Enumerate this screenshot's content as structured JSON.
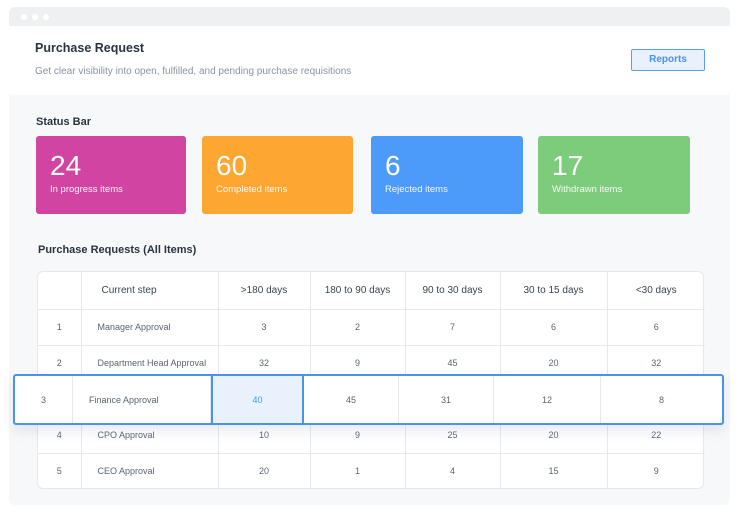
{
  "header": {
    "title": "Purchase Request",
    "subtitle": "Get clear visibility into open, fulfilled, and pending purchase requisitions",
    "reports_label": "Reports"
  },
  "status": {
    "title": "Status Bar",
    "cards": [
      {
        "value": "24",
        "label": "In progress items",
        "color": "#d244a1"
      },
      {
        "value": "60",
        "label": "Completed items",
        "color": "#fea632"
      },
      {
        "value": "6",
        "label": "Rejected items",
        "color": "#4c9bfa"
      },
      {
        "value": "17",
        "label": "Withdrawn items",
        "color": "#7dcc7b"
      }
    ]
  },
  "table": {
    "title": "Purchase Requests (All Items)",
    "headers": [
      "",
      "Current step",
      ">180 days",
      "180 to 90 days",
      "90 to 30 days",
      "30 to 15 days",
      "<30 days"
    ],
    "rows": [
      {
        "index": "1",
        "step": "Manager Approval",
        "values": [
          "3",
          "2",
          "7",
          "6",
          "6"
        ]
      },
      {
        "index": "2",
        "step": "Department Head Approval",
        "values": [
          "32",
          "9",
          "45",
          "20",
          "32"
        ]
      },
      {
        "index": "3",
        "step": "Finance Approval",
        "values": [
          "40",
          "45",
          "31",
          "12",
          "8"
        ]
      },
      {
        "index": "4",
        "step": "CPO Approval",
        "values": [
          "10",
          "9",
          "25",
          "20",
          "22"
        ]
      },
      {
        "index": "5",
        "step": "CEO Approval",
        "values": [
          "20",
          "1",
          "4",
          "15",
          "9"
        ]
      }
    ],
    "selected_row": 2,
    "selected_col": 0,
    "accent": "#4a93ea"
  }
}
